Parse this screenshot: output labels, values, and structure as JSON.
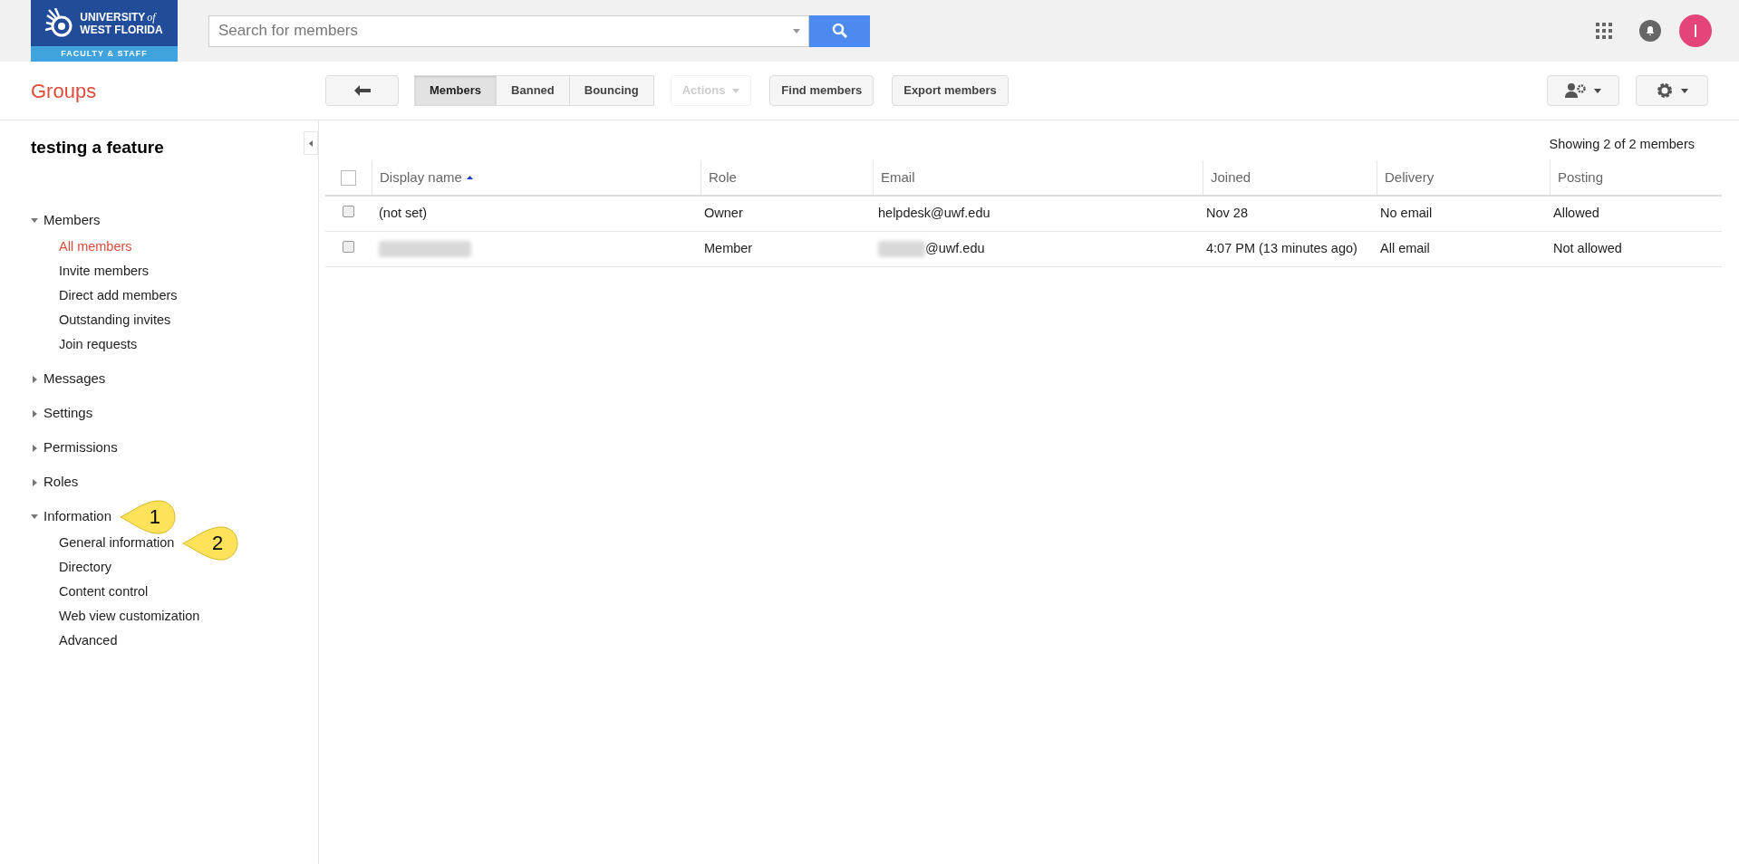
{
  "header": {
    "logo": {
      "line1": "UNIVERSITY",
      "of": "of",
      "line2": "WEST FLORIDA",
      "band": "FACULTY & STAFF"
    },
    "search": {
      "placeholder": "Search for members"
    },
    "avatar": "I"
  },
  "toolbar": {
    "title": "Groups",
    "tabs": [
      {
        "label": "Members",
        "selected": true
      },
      {
        "label": "Banned",
        "selected": false
      },
      {
        "label": "Bouncing",
        "selected": false
      }
    ],
    "buttons": [
      {
        "label": "Actions",
        "disabled": true,
        "dropdown": true
      },
      {
        "label": "Find members",
        "disabled": false,
        "dropdown": false
      },
      {
        "label": "Export members",
        "disabled": false,
        "dropdown": false
      }
    ]
  },
  "sidebar": {
    "group_name": "testing a feature",
    "sections": [
      {
        "label": "Members",
        "expanded": true,
        "children": [
          {
            "label": "All members",
            "selected": true
          },
          {
            "label": "Invite members",
            "selected": false
          },
          {
            "label": "Direct add members",
            "selected": false
          },
          {
            "label": "Outstanding invites",
            "selected": false
          },
          {
            "label": "Join requests",
            "selected": false
          }
        ]
      },
      {
        "label": "Messages",
        "expanded": false
      },
      {
        "label": "Settings",
        "expanded": false
      },
      {
        "label": "Permissions",
        "expanded": false
      },
      {
        "label": "Roles",
        "expanded": false
      },
      {
        "label": "Information",
        "expanded": true,
        "callout": "1",
        "children": [
          {
            "label": "General information",
            "selected": false,
            "callout": "2"
          },
          {
            "label": "Directory",
            "selected": false
          },
          {
            "label": "Content control",
            "selected": false
          },
          {
            "label": "Web view customization",
            "selected": false
          },
          {
            "label": "Advanced",
            "selected": false
          }
        ]
      }
    ]
  },
  "table": {
    "summary": "Showing 2 of 2 members",
    "select_all": {
      "checked": false
    },
    "columns": [
      {
        "label": "Display name",
        "sorted": true
      },
      {
        "label": "Role",
        "sorted": false
      },
      {
        "label": "Email",
        "sorted": false
      },
      {
        "label": "Joined",
        "sorted": false
      },
      {
        "label": "Delivery",
        "sorted": false
      },
      {
        "label": "Posting",
        "sorted": false
      }
    ],
    "rows": [
      {
        "checked": false,
        "name": "(not set)",
        "name_redacted": false,
        "role": "Owner",
        "email": "helpdesk@uwf.edu",
        "email_redacted": false,
        "joined": "Nov 28",
        "delivery": "No email",
        "posting": "Allowed"
      },
      {
        "checked": false,
        "name_redacted": true,
        "role": "Member",
        "email": "@uwf.edu",
        "email_redacted": true,
        "joined": "4:07 PM (13 minutes ago)",
        "delivery": "All email",
        "posting": "Not allowed"
      }
    ]
  }
}
